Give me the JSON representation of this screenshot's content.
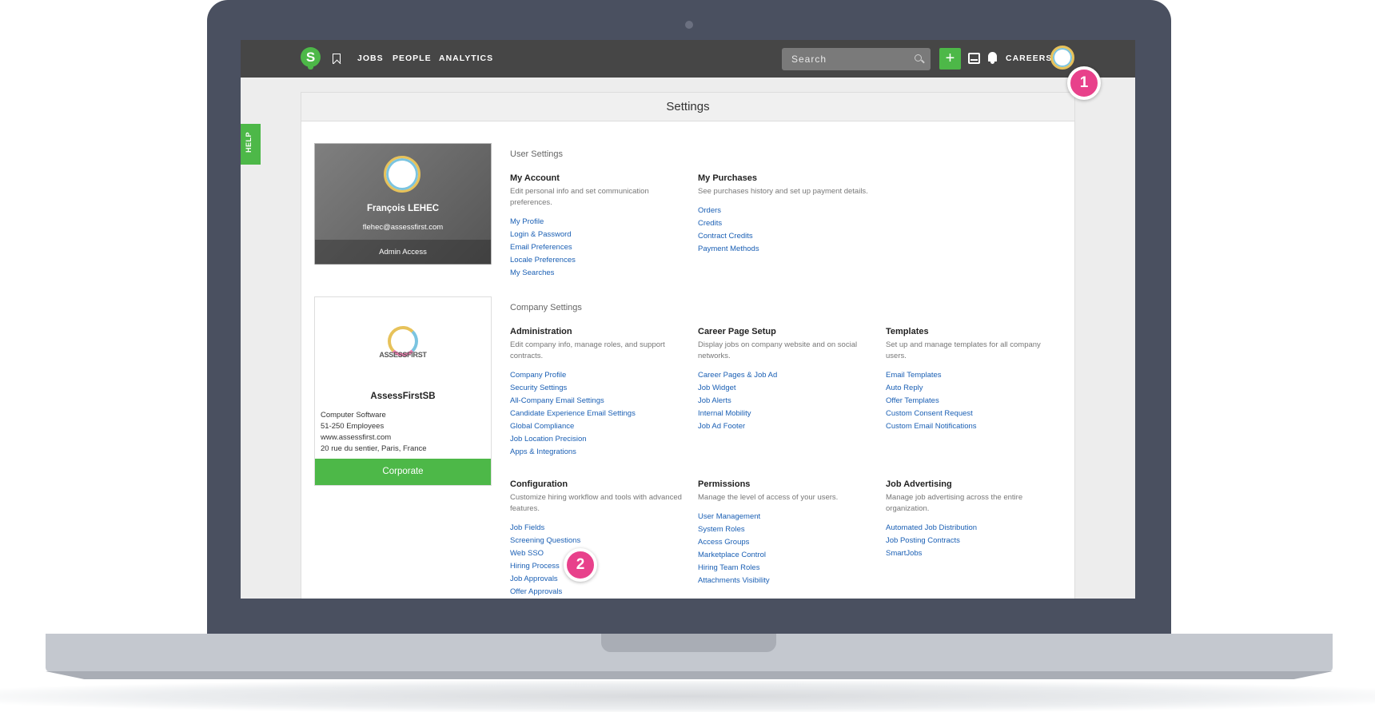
{
  "nav": {
    "logo_letter": "S",
    "links": [
      "JOBS",
      "PEOPLE",
      "ANALYTICS"
    ],
    "search_placeholder": "Search",
    "plus_label": "+",
    "careers_label": "CAREERS"
  },
  "callouts": [
    "1",
    "2"
  ],
  "help_label": "HELP",
  "page_title": "Settings",
  "user_card": {
    "name": "François LEHEC",
    "email": "flehec@assessfirst.com",
    "access": "Admin Access"
  },
  "company_card": {
    "logo_text": "ASSESSFIRST",
    "name": "AssessFirstSB",
    "industry": "Computer Software",
    "size": "51-250 Employees",
    "website": "www.assessfirst.com",
    "address": "20 rue du sentier, Paris, France",
    "plan": "Corporate"
  },
  "user_settings": {
    "title": "User Settings",
    "groups": [
      {
        "title": "My Account",
        "desc": "Edit personal info and set communication preferences.",
        "links": [
          "My Profile",
          "Login & Password",
          "Email Preferences",
          "Locale Preferences",
          "My Searches"
        ]
      },
      {
        "title": "My Purchases",
        "desc": "See purchases history and set up payment details.",
        "links": [
          "Orders",
          "Credits",
          "Contract Credits",
          "Payment Methods"
        ]
      }
    ]
  },
  "company_settings": {
    "title": "Company Settings",
    "groups": [
      {
        "title": "Administration",
        "desc": "Edit company info, manage roles, and support contracts.",
        "links": [
          "Company Profile",
          "Security Settings",
          "All-Company Email Settings",
          "Candidate Experience Email Settings",
          "Global Compliance",
          "Job Location Precision",
          "Apps & Integrations"
        ]
      },
      {
        "title": "Career Page Setup",
        "desc": "Display jobs on company website and on social networks.",
        "links": [
          "Career Pages & Job Ad",
          "Job Widget",
          "Job Alerts",
          "Internal Mobility",
          "Job Ad Footer"
        ]
      },
      {
        "title": "Templates",
        "desc": "Set up and manage templates for all company users.",
        "links": [
          "Email Templates",
          "Auto Reply",
          "Offer Templates",
          "Custom Consent Request",
          "Custom Email Notifications"
        ]
      },
      {
        "title": "Configuration",
        "desc": "Customize hiring workflow and tools with advanced features.",
        "links": [
          "Job Fields",
          "Screening Questions",
          "Web SSO",
          "Hiring Process",
          "Job Approvals",
          "Offer Approvals"
        ]
      },
      {
        "title": "Permissions",
        "desc": "Manage the level of access of your users.",
        "links": [
          "User Management",
          "System Roles",
          "Access Groups",
          "Marketplace Control",
          "Hiring Team Roles",
          "Attachments Visibility"
        ]
      },
      {
        "title": "Job Advertising",
        "desc": "Manage job advertising across the entire organization.",
        "links": [
          "Automated Job Distribution",
          "Job Posting Contracts",
          "SmartJobs"
        ]
      }
    ]
  },
  "colors": {
    "brand_green": "#4db848",
    "nav_bg": "#464646",
    "link_blue": "#1a5fb4",
    "callout_pink": "#e8418b",
    "device_frame": "#4a5060"
  }
}
